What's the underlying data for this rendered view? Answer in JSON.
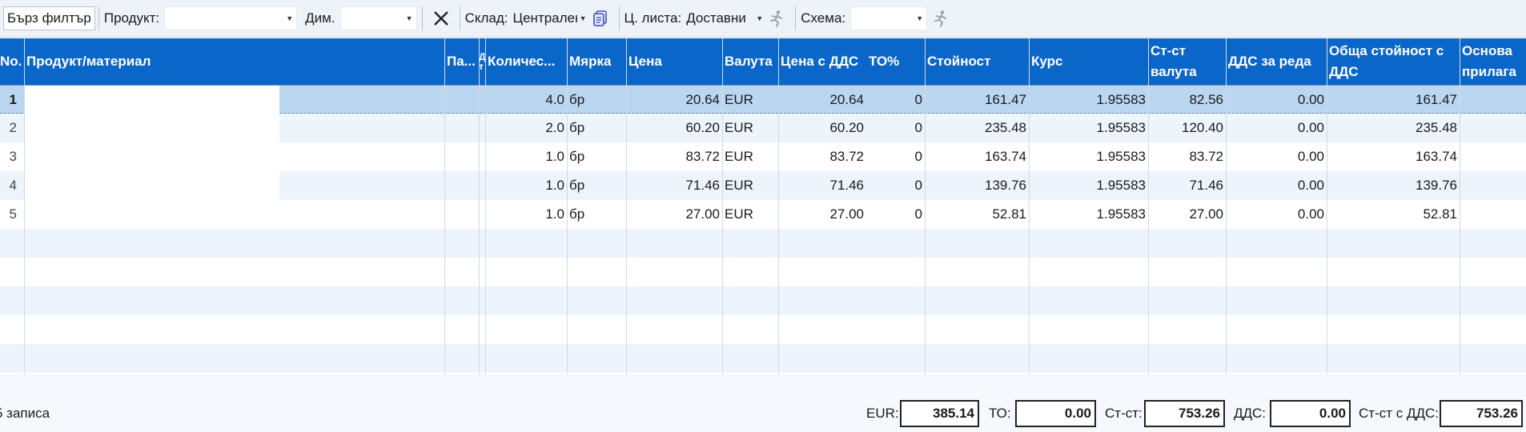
{
  "toolbar": {
    "quick_filter": "Бърз филтър",
    "product_label": "Продукт:",
    "product_value": "",
    "dim_label": "Дим.",
    "dim_value": "",
    "warehouse_label": "Склад:",
    "warehouse_value": "Централен",
    "price_list_label": "Ц. листа:",
    "price_list_value": "Доставни",
    "scheme_label": "Схема:",
    "scheme_value": ""
  },
  "columns": [
    "No.",
    "Продукт/материал",
    "Па...",
    "Д т",
    "Количес...",
    "Мярка",
    "Цена",
    "Валута",
    "Цена с ДДС",
    "ТО%",
    "Стойност",
    "Курс",
    "Ст-ст валута",
    "ДДС за реда",
    "Обща стойност с ДДС",
    "Основа прилага"
  ],
  "rows": [
    {
      "no": "1",
      "qty": "4.0",
      "unit": "бр",
      "price": "20.64",
      "currency": "EUR",
      "price_vat": "20.64",
      "to": "0",
      "value": "161.47",
      "rate": "1.95583",
      "cost_cur": "82.56",
      "vat_row": "0.00",
      "total_vat": "161.47"
    },
    {
      "no": "2",
      "qty": "2.0",
      "unit": "бр",
      "price": "60.20",
      "currency": "EUR",
      "price_vat": "60.20",
      "to": "0",
      "value": "235.48",
      "rate": "1.95583",
      "cost_cur": "120.40",
      "vat_row": "0.00",
      "total_vat": "235.48"
    },
    {
      "no": "3",
      "qty": "1.0",
      "unit": "бр",
      "price": "83.72",
      "currency": "EUR",
      "price_vat": "83.72",
      "to": "0",
      "value": "163.74",
      "rate": "1.95583",
      "cost_cur": "83.72",
      "vat_row": "0.00",
      "total_vat": "163.74"
    },
    {
      "no": "4",
      "qty": "1.0",
      "unit": "бр",
      "price": "71.46",
      "currency": "EUR",
      "price_vat": "71.46",
      "to": "0",
      "value": "139.76",
      "rate": "1.95583",
      "cost_cur": "71.46",
      "vat_row": "0.00",
      "total_vat": "139.76"
    },
    {
      "no": "5",
      "qty": "1.0",
      "unit": "бр",
      "price": "27.00",
      "currency": "EUR",
      "price_vat": "27.00",
      "to": "0",
      "value": "52.81",
      "rate": "1.95583",
      "cost_cur": "27.00",
      "vat_row": "0.00",
      "total_vat": "52.81"
    }
  ],
  "selected_row": 0,
  "status": {
    "records": "5 записа",
    "eur_label": "EUR:",
    "eur_value": "385.14",
    "to_label": "ТО:",
    "to_value": "0.00",
    "cost_label": "Ст-ст:",
    "cost_value": "753.26",
    "vat_label": "ДДС:",
    "vat_value": "0.00",
    "cost_vat_label": "Ст-ст с ДДС:",
    "cost_vat_value": "753.26"
  },
  "icons": {
    "clear_filter": "clear-filter-icon",
    "copy": "copy-icon",
    "running_man": "running-man-icon"
  },
  "colors": {
    "header_bg": "#0a66c8",
    "selected_row": "#bad6f1"
  }
}
